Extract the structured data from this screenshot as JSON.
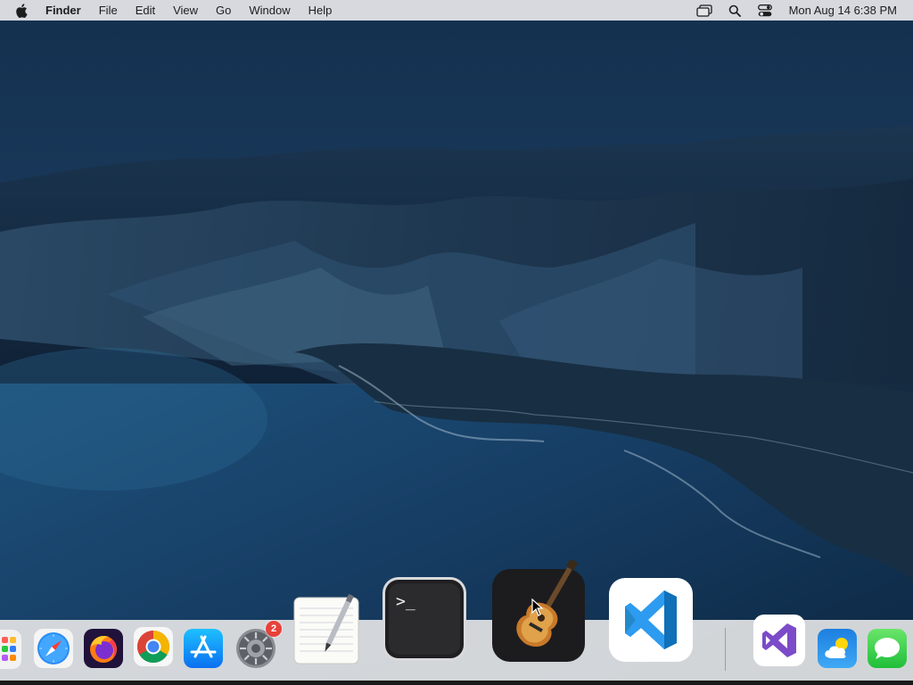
{
  "menubar": {
    "app_name": "Finder",
    "menus": [
      "File",
      "Edit",
      "View",
      "Go",
      "Window",
      "Help"
    ],
    "clock": "Mon Aug 14  6:38 PM",
    "status_icons": [
      "screen-mirroring-icon",
      "spotlight-search-icon",
      "control-center-icon"
    ]
  },
  "dock": {
    "items": [
      {
        "name": "launchpad",
        "icon": "launchpad-icon"
      },
      {
        "name": "safari",
        "icon": "safari-icon"
      },
      {
        "name": "firefox",
        "icon": "firefox-icon"
      },
      {
        "name": "chrome",
        "icon": "chrome-icon"
      },
      {
        "name": "app-store",
        "icon": "app-store-icon"
      },
      {
        "name": "system-preferences",
        "icon": "gear-icon",
        "badge": "2"
      },
      {
        "name": "textedit",
        "icon": "textedit-icon"
      },
      {
        "name": "terminal",
        "icon": "terminal-icon",
        "glyph": ">_"
      },
      {
        "name": "garageband",
        "icon": "guitar-icon"
      },
      {
        "name": "visual-studio-code",
        "icon": "vscode-icon"
      },
      {
        "name": "visual-studio",
        "icon": "visual-studio-icon"
      },
      {
        "name": "weather",
        "icon": "weather-icon"
      },
      {
        "name": "messages",
        "icon": "messages-icon"
      }
    ]
  },
  "colors": {
    "menubar_bg": "#e6e6ea",
    "dock_bg": "#e8e8e8",
    "badge": "#e8413a",
    "sky": "#1d3a5c",
    "sea": "#16395e"
  }
}
